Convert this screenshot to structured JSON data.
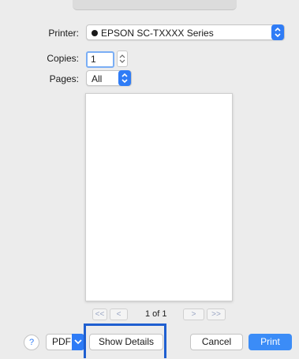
{
  "dialog": {
    "printer_label": "Printer:",
    "printer_value": "EPSON SC-TXXXX Series",
    "copies_label": "Copies:",
    "copies_value": "1",
    "pages_label": "Pages:",
    "pages_value": "All"
  },
  "pager": {
    "first": "<<",
    "prev": "<",
    "text": "1 of 1",
    "next": ">",
    "last": ">>"
  },
  "footer": {
    "help": "?",
    "pdf": "PDF",
    "show_details": "Show Details",
    "cancel": "Cancel",
    "print": "Print"
  },
  "colors": {
    "accent": "#3b8cf7",
    "highlight_border": "#1f5fd0"
  },
  "icons": {
    "printer_status": "status-dot-icon",
    "popup_arrows": "up-down-chevron-icon",
    "pdf_menu": "chevron-down-icon"
  }
}
